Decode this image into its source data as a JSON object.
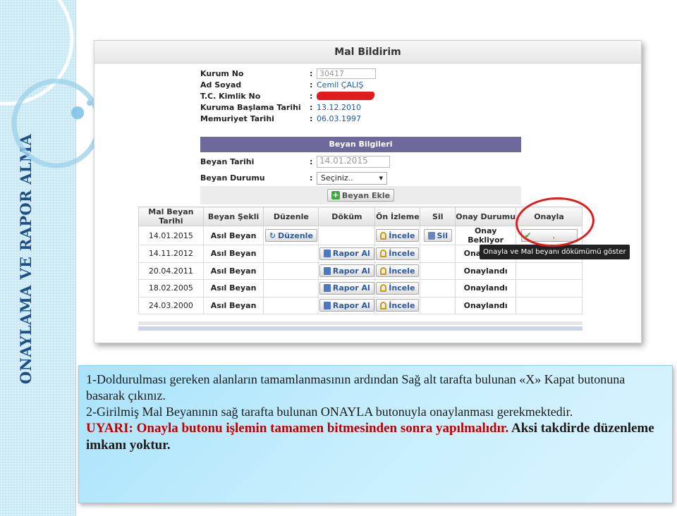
{
  "side_title": "ONAYLAMA VE RAPOR ALMA",
  "window": {
    "title": "Mal Bildirim"
  },
  "info": [
    {
      "label": "Kurum No",
      "value": "30417"
    },
    {
      "label": "Ad Soyad",
      "value": "Cemil ÇALIŞ"
    },
    {
      "label": "T.C. Kimlik No",
      "value": ""
    },
    {
      "label": "Kuruma Başlama Tarihi",
      "value": "13.12.2010"
    },
    {
      "label": "Memuriyet Tarihi",
      "value": "06.03.1997"
    }
  ],
  "colon": ":",
  "beyan": {
    "header": "Beyan Bilgileri",
    "tarih_label": "Beyan Tarihi",
    "tarih_value": "14.01.2015",
    "durum_label": "Beyan Durumu",
    "durum_value": "Seçiniz..",
    "add_button": "Beyan Ekle"
  },
  "table": {
    "headers": [
      "Mal Beyan Tarihi",
      "Beyan Şekli",
      "Düzenle",
      "Döküm",
      "Ön İzleme",
      "Sil",
      "Onay Durumu",
      "Onayla"
    ],
    "buttons": {
      "edit": "Düzenle",
      "report": "Rapor Al",
      "preview": "İncele",
      "delete": "Sil",
      "approve_mark": "."
    },
    "rows": [
      {
        "date": "14.01.2015",
        "type": "Asıl Beyan",
        "status": "Onay Bekliyor"
      },
      {
        "date": "14.11.2012",
        "type": "Asıl Beyan",
        "status": "Onaylandı"
      },
      {
        "date": "20.04.2011",
        "type": "Asıl Beyan",
        "status": "Onaylandı"
      },
      {
        "date": "18.02.2005",
        "type": "Asıl Beyan",
        "status": "Onaylandı"
      },
      {
        "date": "24.03.2000",
        "type": "Asıl Beyan",
        "status": "Onaylandı"
      }
    ],
    "tooltip": "Onayla ve Mal beyanı dökümümü göster"
  },
  "instructions": {
    "line1": "1-Doldurulması gereken alanların tamamlanmasının ardından Sağ alt tarafta bulunan «X» Kapat butonuna basarak çıkınız.",
    "line2": "2-Girilmiş Mal Beyanının sağ tarafta bulunan ONAYLA butonuyla onaylanması gerekmektedir.",
    "warning_red": "UYARI: Onayla butonu işlemin tamamen bitmesinden sonra yapılmalıdır.",
    "warning_black": "Aksi takdirde düzenleme imkanı yoktur."
  },
  "colors": {
    "accent_red": "#e01c1c",
    "link_blue": "#1a5aa8",
    "header_purple": "#6b6a9a",
    "side_blue": "#c8e8f6"
  }
}
